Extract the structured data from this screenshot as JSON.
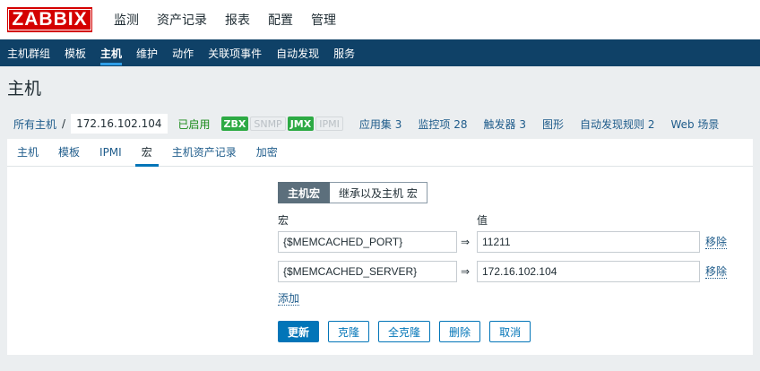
{
  "logo": "ZABBIX",
  "topnav": [
    "监测",
    "资产记录",
    "报表",
    "配置",
    "管理"
  ],
  "topnav_active": "配置",
  "subnav": [
    "主机群组",
    "模板",
    "主机",
    "维护",
    "动作",
    "关联项事件",
    "自动发现",
    "服务"
  ],
  "subnav_active": "主机",
  "page_title": "主机",
  "breadcrumb": {
    "all_hosts": "所有主机",
    "separator": "/",
    "current": "172.16.102.104"
  },
  "status": "已启用",
  "availability": [
    "ZBX",
    "SNMP",
    "JMX",
    "IPMI"
  ],
  "host_nav": [
    {
      "label": "应用集",
      "count": "3"
    },
    {
      "label": "监控项",
      "count": "28"
    },
    {
      "label": "触发器",
      "count": "3"
    },
    {
      "label": "图形",
      "count": ""
    },
    {
      "label": "自动发现规则",
      "count": "2"
    },
    {
      "label": "Web 场景",
      "count": ""
    }
  ],
  "tabs": [
    "主机",
    "模板",
    "IPMI",
    "宏",
    "主机资产记录",
    "加密"
  ],
  "tab_active": "宏",
  "segment": {
    "host_macros": "主机宏",
    "inherited": "继承以及主机 宏"
  },
  "columns": {
    "macro": "宏",
    "value": "值"
  },
  "macros": [
    {
      "macro": "{$MEMCACHED_PORT}",
      "value": "11211",
      "remove": "移除"
    },
    {
      "macro": "{$MEMCACHED_SERVER}",
      "value": "172.16.102.104",
      "remove": "移除"
    }
  ],
  "arrow": "⇒",
  "add_label": "添加",
  "buttons": {
    "update": "更新",
    "clone": "克隆",
    "full_clone": "全克隆",
    "delete": "删除",
    "cancel": "取消"
  },
  "colors": {
    "brand_red": "#d40000",
    "nav_blue": "#0f4167",
    "link": "#1f5c8b",
    "primary": "#0275b8",
    "green": "#2daa44"
  }
}
